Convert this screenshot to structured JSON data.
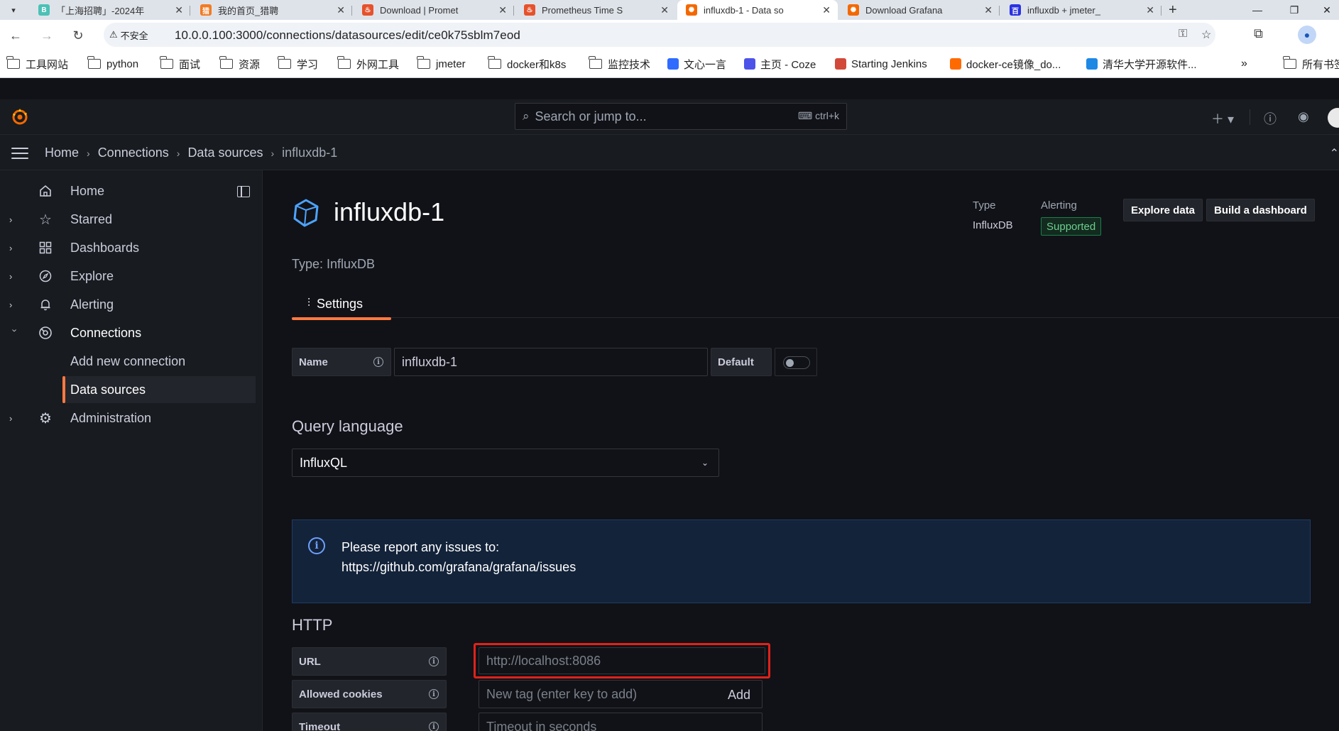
{
  "browser": {
    "tabs": [
      {
        "title": "「上海招聘」-2024年",
        "fav_color": "#4cc1b6",
        "fav_glyph": "B"
      },
      {
        "title": "我的首页_猎聘",
        "fav_color": "#f27b22",
        "fav_glyph": "猎"
      },
      {
        "title": "Download | Promet",
        "fav_color": "#e6522c",
        "fav_glyph": "♨"
      },
      {
        "title": "Prometheus Time S",
        "fav_color": "#e6522c",
        "fav_glyph": "♨"
      },
      {
        "title": "influxdb-1 - Data so",
        "fav_color": "#f46800",
        "fav_glyph": "✺",
        "active": true
      },
      {
        "title": "Download Grafana",
        "fav_color": "#f46800",
        "fav_glyph": "✺"
      },
      {
        "title": "influxdb + jmeter_",
        "fav_color": "#2932e1",
        "fav_glyph": "百"
      }
    ],
    "insecure_label": "不安全",
    "url": "10.0.0.100:3000/connections/datasources/edit/ce0k75sblm7eod",
    "bookmarks": [
      {
        "label": "工具网站",
        "type": "folder"
      },
      {
        "label": "python",
        "type": "folder"
      },
      {
        "label": "面试",
        "type": "folder"
      },
      {
        "label": "资源",
        "type": "folder"
      },
      {
        "label": "学习",
        "type": "folder"
      },
      {
        "label": "外网工具",
        "type": "folder"
      },
      {
        "label": "jmeter",
        "type": "folder"
      },
      {
        "label": "docker和k8s",
        "type": "folder"
      },
      {
        "label": "监控技术",
        "type": "folder"
      },
      {
        "label": "文心一言",
        "type": "site",
        "color": "#2f6bff"
      },
      {
        "label": "主页 - Coze",
        "type": "site",
        "color": "#4d53e8"
      },
      {
        "label": "Starting Jenkins",
        "type": "site",
        "color": "#d24939"
      },
      {
        "label": "docker-ce镜像_do...",
        "type": "site",
        "color": "#ff6a00"
      },
      {
        "label": "清华大学开源软件...",
        "type": "site",
        "color": "#1e88e5"
      },
      {
        "label": "所有书签",
        "type": "folder"
      }
    ]
  },
  "grafana": {
    "search_placeholder": "Search or jump to...",
    "search_shortcut": "ctrl+k",
    "breadcrumbs": [
      "Home",
      "Connections",
      "Data sources",
      "influxdb-1"
    ],
    "nav": {
      "home": "Home",
      "starred": "Starred",
      "dashboards": "Dashboards",
      "explore": "Explore",
      "alerting": "Alerting",
      "connections": "Connections",
      "add_new_connection": "Add new connection",
      "data_sources": "Data sources",
      "administration": "Administration"
    },
    "datasource": {
      "title": "influxdb-1",
      "type_line": "Type: InfluxDB",
      "meta_type_label": "Type",
      "meta_type_value": "InfluxDB",
      "meta_alerting_label": "Alerting",
      "meta_alerting_value": "Supported",
      "explore_btn": "Explore data",
      "build_btn": "Build a dashboard",
      "settings_tab": "Settings"
    },
    "form": {
      "name_label": "Name",
      "name_value": "influxdb-1",
      "default_label": "Default",
      "default_on": false,
      "query_language_title": "Query language",
      "query_language_value": "InfluxQL",
      "alert_line1": "Please report any issues to:",
      "alert_line2": "https://github.com/grafana/grafana/issues",
      "http_title": "HTTP",
      "url_label": "URL",
      "url_placeholder": "http://localhost:8086",
      "cookies_label": "Allowed cookies",
      "cookies_placeholder": "New tag (enter key to add)",
      "cookies_add": "Add",
      "timeout_label": "Timeout",
      "timeout_placeholder": "Timeout in seconds"
    }
  }
}
